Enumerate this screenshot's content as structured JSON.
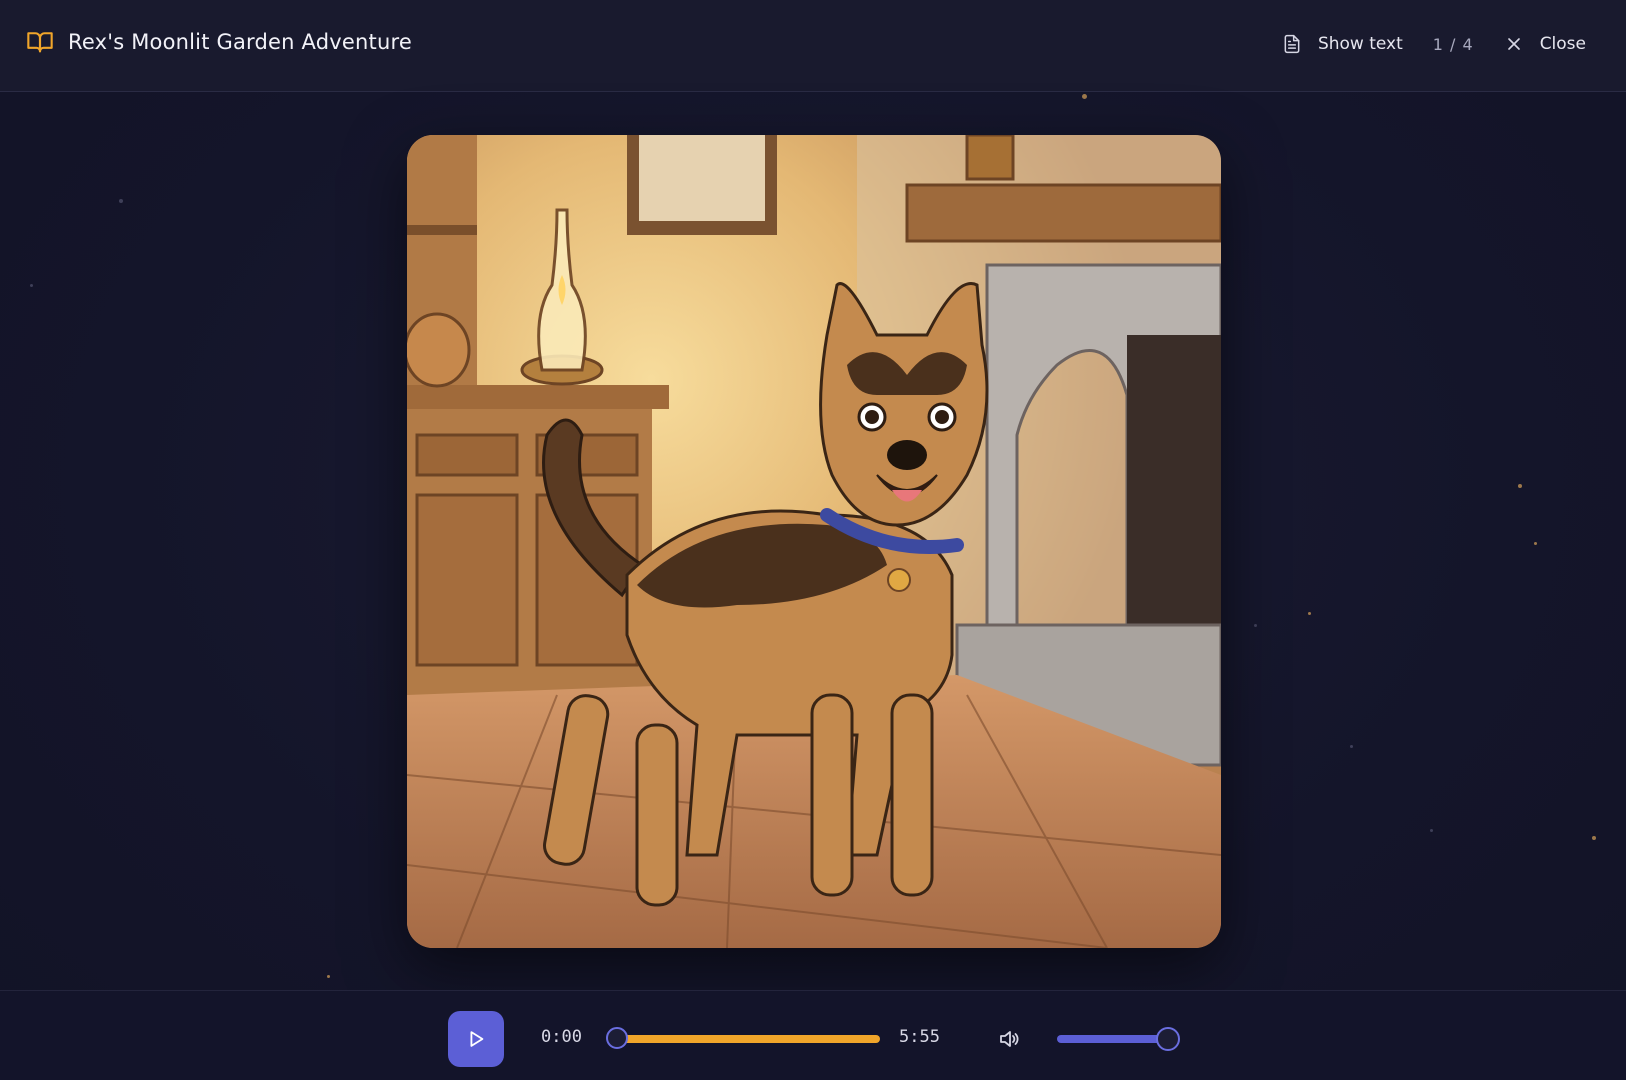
{
  "header": {
    "title": "Rex's Moonlit Garden Adventure",
    "show_text_label": "Show text",
    "page_indicator": "1 / 4",
    "close_label": "Close"
  },
  "icons": {
    "book": "book-open-icon",
    "show_text": "document-icon",
    "close": "close-icon",
    "play": "play-icon",
    "volume": "volume-icon"
  },
  "player": {
    "current_time": "0:00",
    "duration": "5:55",
    "progress_fraction": 0.0,
    "volume_fraction": 1.0
  },
  "colors": {
    "accent_orange": "#f0a52a",
    "accent_purple": "#5c5fd6",
    "background": "#141528"
  }
}
